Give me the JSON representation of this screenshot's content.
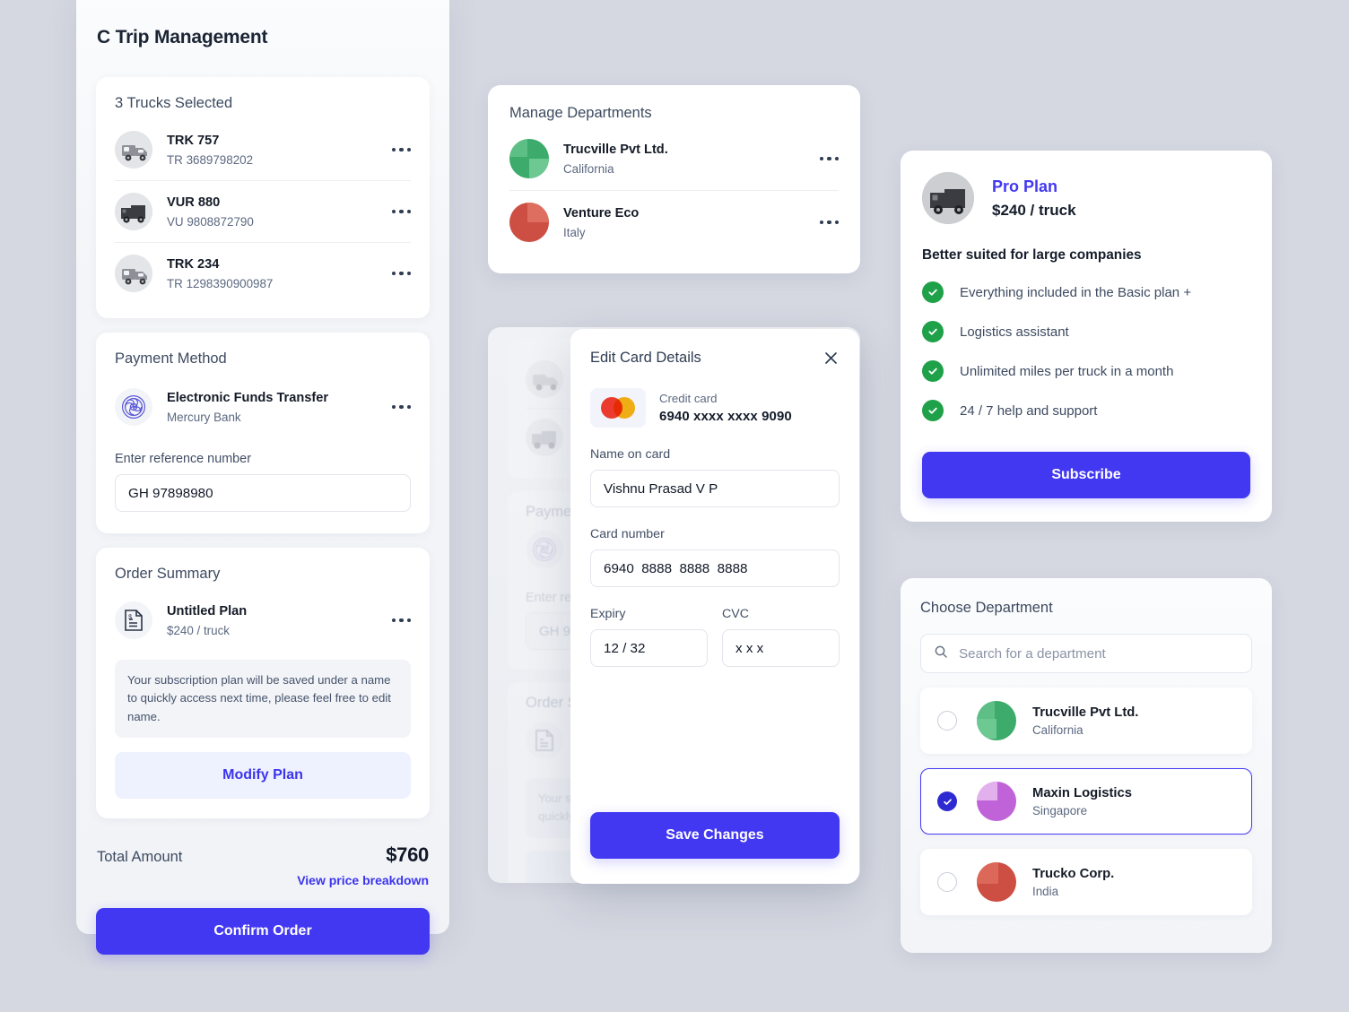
{
  "app": {
    "title": "C Trip Management"
  },
  "trucks_card": {
    "title": "3 Trucks Selected",
    "items": [
      {
        "name": "TRK 757",
        "id": "TR 3689798202"
      },
      {
        "name": "VUR 880",
        "id": "VU 9808872790"
      },
      {
        "name": "TRK 234",
        "id": "TR 1298390900987"
      }
    ]
  },
  "payment_card": {
    "title": "Payment Method",
    "method_name": "Electronic Funds Transfer",
    "method_bank": "Mercury Bank",
    "reference_label": "Enter reference number",
    "reference_value": "GH 97898980",
    "reference_placeholder": "GH 97898980"
  },
  "order_card": {
    "title": "Order Summary",
    "plan_name": "Untitled Plan",
    "plan_price": "$240 / truck",
    "note": "Your subscription plan will be saved under a name to quickly access next time, please feel free to edit name.",
    "modify_label": "Modify Plan"
  },
  "totals": {
    "label": "Total Amount",
    "amount": "$760",
    "breakdown_link": "View price breakdown",
    "confirm_label": "Confirm Order"
  },
  "departments_card": {
    "title": "Manage Departments",
    "items": [
      {
        "name": "Trucville Pvt Ltd.",
        "location": "California",
        "color": "#3cab6b"
      },
      {
        "name": "Venture Eco",
        "location": "Italy",
        "color": "#cd4e42"
      }
    ]
  },
  "backdrop": {
    "payment_title": "Paymen",
    "reference_label": "Enter ref",
    "reference_value": "GH 9",
    "order_title": "Order S",
    "note_line1": "Your sub",
    "note_line2": "quickly"
  },
  "modal": {
    "title": "Edit Card Details",
    "close_icon": "close-icon",
    "card_kind": "Credit card",
    "card_masked": "6940 xxxx xxxx 9090",
    "name_label": "Name on card",
    "name_value": "Vishnu Prasad V P",
    "number_label": "Card number",
    "number_value": "6940  8888  8888  8888",
    "expiry_label": "Expiry",
    "expiry_value": "12 / 32",
    "cvc_label": "CVC",
    "cvc_value": "x x x",
    "save_label": "Save Changes"
  },
  "plan_card": {
    "name": "Pro Plan",
    "price": "$240 / truck",
    "tagline": "Better suited for large companies",
    "features": [
      "Everything included in the Basic plan +",
      "Logistics assistant",
      "Unlimited miles per truck in a month",
      "24 / 7 help and support"
    ],
    "subscribe_label": "Subscribe"
  },
  "choose_card": {
    "title": "Choose Department",
    "search_placeholder": "Search for a department",
    "search_value": "",
    "options": [
      {
        "name": "Trucville Pvt Ltd.",
        "location": "California",
        "selected": false,
        "color": "#3cab6b"
      },
      {
        "name": "Maxin Logistics",
        "location": "Singapore",
        "selected": true,
        "color": "#c063d8"
      },
      {
        "name": "Trucko Corp.",
        "location": "India",
        "selected": false,
        "color": "#cd4e42"
      }
    ]
  },
  "colors": {
    "accent": "#4338f2",
    "accent_soft": "#eef1fe",
    "success": "#1fa14a",
    "page_bg": "#d5d8e1",
    "panel_bg": "#f3f5f8"
  }
}
